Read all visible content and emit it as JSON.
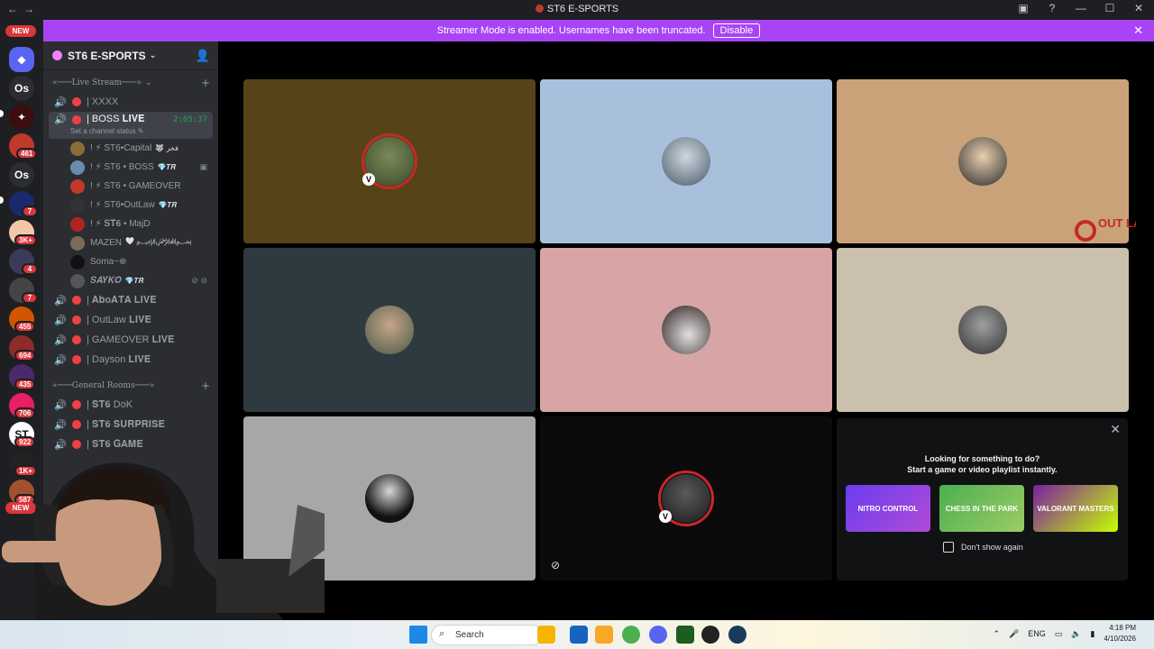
{
  "window": {
    "title": "ST6 E-SPORTS",
    "nav_back": "←",
    "nav_forward": "→"
  },
  "banner": {
    "text": "Streamer Mode is enabled. Usernames have been truncated.",
    "button": "Disable"
  },
  "rail": {
    "new_top": "NEW",
    "new_bottom": "NEW",
    "initials_1": "Os",
    "initials_2": "Os",
    "badges": [
      "461",
      "7",
      "3K+",
      "4",
      "7",
      "455",
      "694",
      "435",
      "706",
      "922",
      "1K+",
      "587"
    ]
  },
  "server": {
    "name": "ST6 E-SPORTS"
  },
  "categories": {
    "live": "«───Live Stream───»",
    "general": "«───General Rooms───»"
  },
  "channels": {
    "xxxx": "| XXXX",
    "boss": "| BOSS 𝐋𝐈𝐕𝐄",
    "boss_time": "2:05:37",
    "boss_status": "Set a channel status",
    "aboata": "| 𝐀𝐛𝐨𝐀𝐓𝐀 𝐋𝐈𝐕𝐄",
    "outlaw": "| OutLaw 𝐋𝐈𝐕𝐄",
    "gameover": "| GAMEOVER 𝐋𝐈𝐕𝐄",
    "dayson": "| Dayson 𝐋𝐈𝐕𝐄",
    "dok": "| 𝐒𝐓𝟔 DoK",
    "surprise": "| 𝐒𝐓𝟔 𝐒𝐔𝐑𝐏𝐑𝐈𝐒𝐄",
    "game": "| 𝐒𝐓𝟔 𝐆𝐀𝐌𝐄"
  },
  "users": [
    {
      "name": "! ⚡ ST6•Capital",
      "tag": "🐺 فخر"
    },
    {
      "name": "! ⚡ ST6 • BOSS",
      "tag": "💎𝑻𝑹"
    },
    {
      "name": "! ⚡ ST6 • GAMEOVER",
      "tag": ""
    },
    {
      "name": "! ⚡ ST6•OutLaw",
      "tag": "💎𝑻𝑹"
    },
    {
      "name": "! ⚡ 𝐒𝐓𝟔 • MajD",
      "tag": ""
    },
    {
      "name": "MAZEN",
      "tag": "🤍 ﷽"
    },
    {
      "name": "Soma~⊕",
      "tag": ""
    },
    {
      "name": "𝑺𝑨𝒀𝑲𝑶",
      "tag": "💎𝑻𝑹"
    }
  ],
  "panel": {
    "line1": "Looking for something to do?",
    "line2": "Start a game or video playlist instantly.",
    "cards": [
      "NITRO CONTROL",
      "CHESS IN THE PARK",
      "VALORANT MASTERS"
    ],
    "dont_show": "Don't show again"
  },
  "overlay_logo": "OUT LAW",
  "taskbar": {
    "search": "Search",
    "lang": "ENG",
    "time": "4:18 PM",
    "date": "4/10/2026"
  },
  "colors": {
    "accent": "#a844f5",
    "live_green": "#23a55a",
    "red": "#ed4245"
  }
}
